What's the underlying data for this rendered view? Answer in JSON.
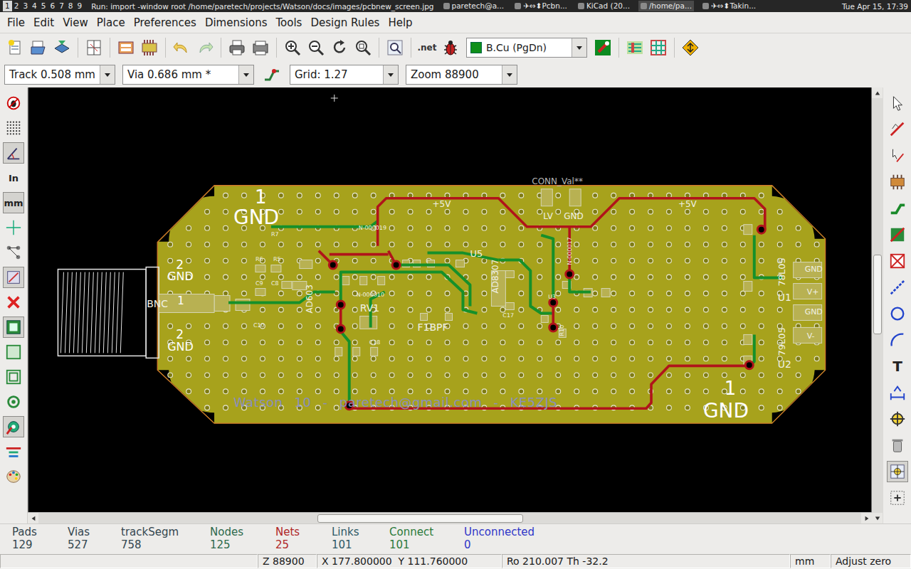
{
  "taskbar": {
    "workspaces": [
      {
        "label": "1",
        "selected": true
      },
      {
        "label": "2",
        "selected": false
      },
      {
        "label": "3",
        "selected": false
      },
      {
        "label": "4",
        "selected": false
      },
      {
        "label": "5",
        "selected": false
      },
      {
        "label": "6",
        "selected": false
      },
      {
        "label": "7",
        "selected": false
      },
      {
        "label": "8",
        "selected": false
      },
      {
        "label": "9",
        "selected": false
      }
    ],
    "run": "Run: import -window root /home/paretech/projects/Watson/docs/images/pcbnew_screen.jpg",
    "tasks": [
      {
        "label": "paretech@a...",
        "selected": false
      },
      {
        "label": "✈⇔⬍Pcbn...",
        "selected": false
      },
      {
        "label": "KiCad (20...",
        "selected": false
      },
      {
        "label": "/home/pa...",
        "selected": true
      },
      {
        "label": "✈⇔⬍Takin...",
        "selected": false
      }
    ],
    "clock": "Tue Apr 15, 17:39"
  },
  "menu": [
    "File",
    "Edit",
    "View",
    "Place",
    "Preferences",
    "Dimensions",
    "Tools",
    "Design Rules",
    "Help"
  ],
  "toolbar": {
    "netlist_label": ".net",
    "layer": "B.Cu (PgDn)"
  },
  "options": {
    "track": "Track 0.508 mm",
    "via": "Via 0.686 mm *",
    "grid": "Grid: 1.27",
    "zoom": "Zoom 88900"
  },
  "left_toolbar": [
    {
      "kind": "icon",
      "selected": false
    },
    {
      "kind": "icon",
      "selected": false
    },
    {
      "kind": "icon",
      "selected": true
    },
    {
      "kind": "text",
      "label": "In",
      "selected": false
    },
    {
      "kind": "text",
      "label": "mm",
      "selected": true
    },
    {
      "kind": "icon",
      "selected": false
    },
    {
      "kind": "icon",
      "selected": false
    },
    {
      "kind": "icon",
      "selected": true
    },
    {
      "kind": "icon",
      "selected": false
    },
    {
      "kind": "icon",
      "selected": true
    },
    {
      "kind": "icon",
      "selected": false
    },
    {
      "kind": "icon",
      "selected": false
    },
    {
      "kind": "icon",
      "selected": false
    },
    {
      "kind": "icon",
      "selected": true
    },
    {
      "kind": "icon",
      "selected": false
    },
    {
      "kind": "icon",
      "selected": false
    }
  ],
  "right_toolbar": [
    {
      "kind": "icon",
      "selected": false
    },
    {
      "kind": "icon",
      "selected": false
    },
    {
      "kind": "icon",
      "selected": false
    },
    {
      "kind": "icon",
      "selected": false
    },
    {
      "kind": "icon",
      "selected": false
    },
    {
      "kind": "icon",
      "selected": false
    },
    {
      "kind": "icon",
      "selected": false
    },
    {
      "kind": "icon",
      "selected": false
    },
    {
      "kind": "icon",
      "selected": false
    },
    {
      "kind": "icon",
      "selected": false
    },
    {
      "kind": "text",
      "label": "T",
      "selected": false
    },
    {
      "kind": "icon",
      "selected": false
    },
    {
      "kind": "icon",
      "selected": false
    },
    {
      "kind": "icon",
      "selected": false
    },
    {
      "kind": "icon",
      "selected": true
    },
    {
      "kind": "icon",
      "selected": false
    }
  ],
  "board": {
    "labels": [
      "1",
      "GND",
      "2",
      "GND",
      "BNC",
      "1",
      "2",
      "GND",
      "CONN_Val**",
      "LV",
      "GND",
      "+5V",
      "+5V",
      "N-000019",
      "N-000010",
      "U5",
      "AD8307",
      "AD603",
      "RV1",
      "F1BPF",
      "78L05",
      "U1",
      "79L05",
      "U2",
      "GND",
      "V+",
      "GND",
      "V-",
      "1",
      "GND",
      "Watson 10 - paretech@gmail.com - KE5ZJS",
      "R7",
      "R6",
      "R5",
      "C9",
      "C8",
      "C10",
      "C17",
      "C18",
      "R10",
      "U3",
      "N-000017"
    ]
  },
  "counters": [
    {
      "label": "Pads",
      "value": "129",
      "color": "#34464f"
    },
    {
      "label": "Vias",
      "value": "527",
      "color": "#34464f"
    },
    {
      "label": "trackSegm",
      "value": "758",
      "color": "#34464f"
    },
    {
      "label": "Nodes",
      "value": "125",
      "color": "#2e6a4c"
    },
    {
      "label": "Nets",
      "value": "25",
      "color": "#b02828"
    },
    {
      "label": "Links",
      "value": "101",
      "color": "#2c5866"
    },
    {
      "label": "Connect",
      "value": "101",
      "color": "#2a7a3a"
    },
    {
      "label": "Unconnected",
      "value": "0",
      "color": "#2f36c8"
    }
  ],
  "statusbar": {
    "zoom": "Z 88900",
    "coords": "X 177.800000  Y 111.760000",
    "polar": "Ro 210.007 Th -32.2",
    "units": "mm",
    "adjust": "Adjust zero"
  }
}
